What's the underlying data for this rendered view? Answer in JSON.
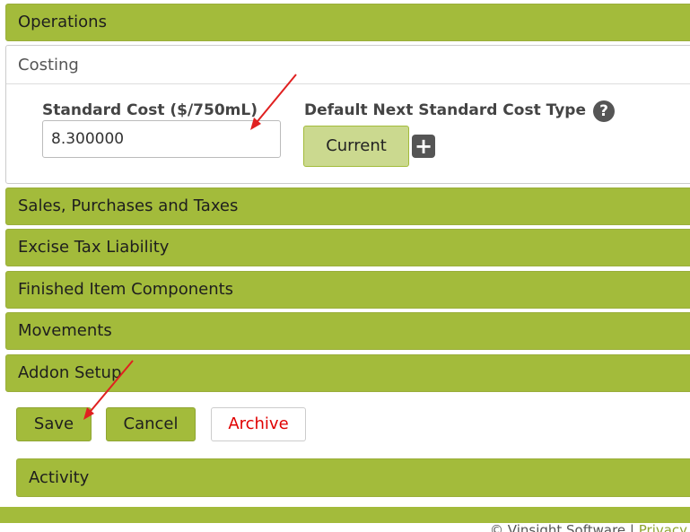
{
  "panels": {
    "operations": "Operations",
    "costing": "Costing",
    "sales": "Sales, Purchases and Taxes",
    "excise": "Excise Tax Liability",
    "finished": "Finished Item Components",
    "movements": "Movements",
    "addon": "Addon Setup",
    "activity": "Activity"
  },
  "costing": {
    "standard_cost_label": "Standard Cost ($/750mL)",
    "standard_cost_value": "8.300000",
    "next_type_label": "Default Next Standard Cost Type",
    "next_type_value": "Current",
    "help_glyph": "?",
    "plus_glyph": "+"
  },
  "actions": {
    "save": "Save",
    "cancel": "Cancel",
    "archive": "Archive"
  },
  "footer": {
    "copyright": "© Vinsight Software | ",
    "privacy": "Privacy S"
  },
  "colors": {
    "accent": "#a3bb3b",
    "button_light": "#cbd98f",
    "archive_text": "#e00000",
    "annotation_arrow": "#e02020"
  },
  "icons": {
    "help": "question-circle-icon",
    "add": "plus-square-icon"
  }
}
